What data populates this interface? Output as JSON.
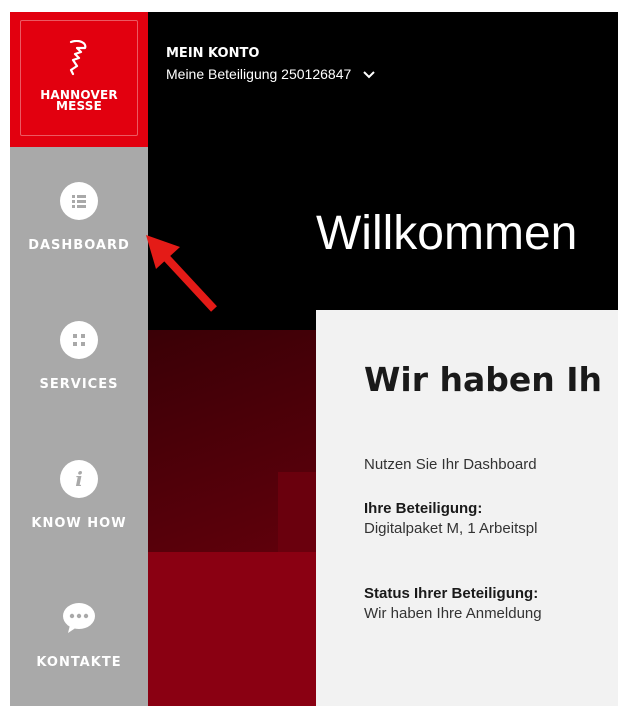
{
  "logo": {
    "line1": "HANNOVER",
    "line2": "MESSE"
  },
  "sidebar": {
    "items": [
      {
        "label": "DASHBOARD",
        "icon": "list-icon"
      },
      {
        "label": "SERVICES",
        "icon": "grid-icon"
      },
      {
        "label": "KNOW HOW",
        "icon": "info-icon"
      },
      {
        "label": "KONTAKTE",
        "icon": "chat-icon"
      }
    ]
  },
  "header": {
    "account_title": "MEIN KONTO",
    "account_subtitle": "Meine Beteiligung 250126847"
  },
  "main": {
    "welcome": "Willkommen",
    "card": {
      "heading": "Wir haben Ih",
      "intro": "Nutzen Sie Ihr Dashboard",
      "participation_label": "Ihre Beteiligung:",
      "participation_value": "Digitalpaket M, 1 Arbeitspl",
      "status_label": "Status Ihrer Beteiligung:",
      "status_value": "Wir haben Ihre Anmeldung"
    }
  },
  "colors": {
    "brand_red": "#e2000f",
    "sidebar_gray": "#a9a9a9",
    "arrow_red": "#e41b17"
  }
}
